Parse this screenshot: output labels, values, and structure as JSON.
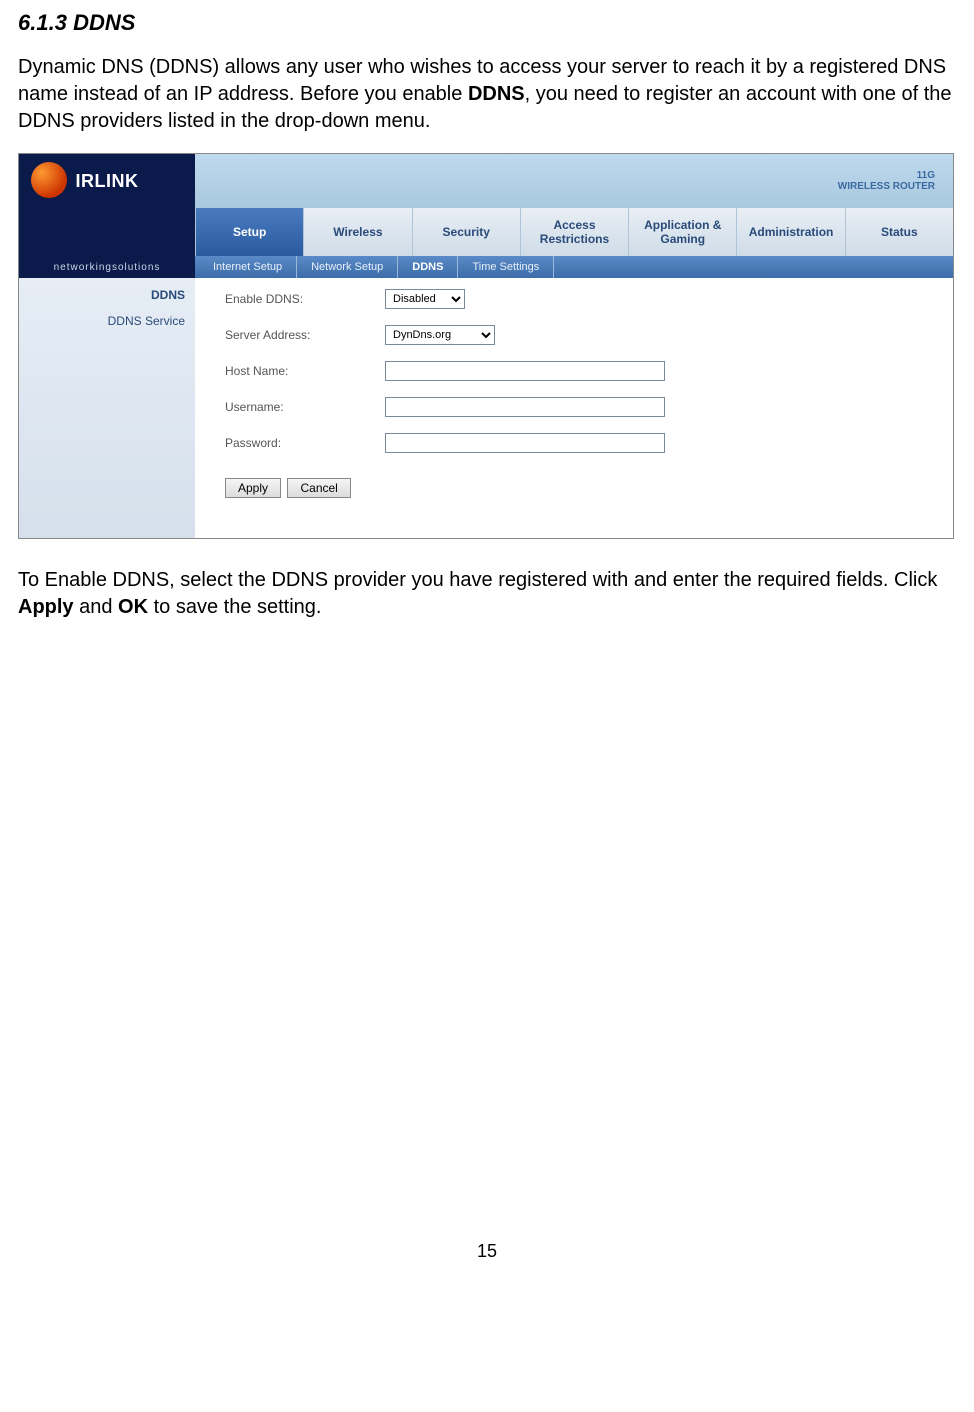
{
  "section": {
    "number": "6.1.3",
    "title": "DDNS"
  },
  "paragraph1_pre": "Dynamic DNS (DDNS) allows any user who wishes to access your server to reach it by a registered DNS name instead of an IP address. Before you enable ",
  "paragraph1_bold": "DDNS",
  "paragraph1_post": ", you need to register an account with one of the DDNS providers listed in the drop-down menu.",
  "paragraph2_pre": "To Enable DDNS, select the DDNS provider you have registered with and enter the required fields. Click ",
  "paragraph2_b1": "Apply",
  "paragraph2_mid": " and ",
  "paragraph2_b2": "OK",
  "paragraph2_post": " to save the setting.",
  "page_number": "15",
  "router": {
    "logo_text": "IRLINK",
    "banner_line1": "11G",
    "banner_line2": "WIRELESS ROUTER",
    "networking_solutions": "networkingsolutions",
    "main_nav": [
      "Setup",
      "Wireless",
      "Security",
      "Access Restrictions",
      "Application & Gaming",
      "Administration",
      "Status"
    ],
    "main_nav_active": 0,
    "sub_nav": [
      "Internet Setup",
      "Network Setup",
      "DDNS",
      "Time Settings"
    ],
    "sub_nav_active": 2,
    "side_heading": "DDNS",
    "side_label": "DDNS Service",
    "form": {
      "enable_label": "Enable DDNS:",
      "enable_value": "Disabled",
      "server_label": "Server Address:",
      "server_value": "DynDns.org",
      "host_label": "Host Name:",
      "host_value": "",
      "user_label": "Username:",
      "user_value": "",
      "pass_label": "Password:",
      "pass_value": "",
      "apply": "Apply",
      "cancel": "Cancel"
    }
  }
}
